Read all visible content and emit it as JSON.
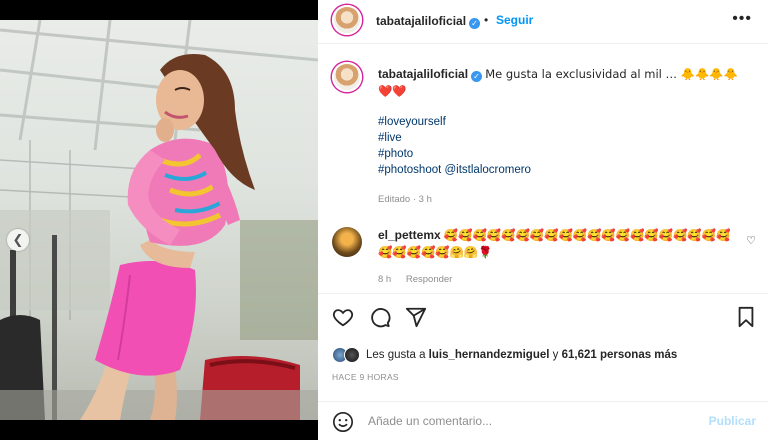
{
  "post": {
    "author": "tabatajaliloficial",
    "separator": "•",
    "follow_label": "Seguir",
    "more_label": "•••",
    "caption": "Me gusta la exclusividad al mil … 🐥🐥🐥🐥 ❤️❤️",
    "hashtags": [
      "#loveyourself",
      "#live",
      "#photo",
      "#photoshoot @itstlalocromero"
    ],
    "edited_meta": "Editado · 3 h"
  },
  "comment": {
    "author": "el_pettemx",
    "text": "🥰🥰🥰🥰🥰🥰🥰🥰🥰🥰🥰🥰🥰🥰🥰🥰🥰🥰🥰🥰🥰🥰🥰🥰🥰🤗🤗🌹",
    "time": "8 h",
    "reply_label": "Responder"
  },
  "likes": {
    "prefix": "Les gusta a",
    "user": "luis_hernandezmiguel",
    "middle": "y",
    "count": "61,621 personas más"
  },
  "time_ago": "HACE 9 HORAS",
  "add_comment": {
    "placeholder": "Añade un comentario...",
    "publish_label": "Publicar"
  },
  "carousel": {
    "slides": 5,
    "active_index": 4
  },
  "icons": [
    "chevron-left-icon",
    "verified-icon",
    "more-icon",
    "heart-icon",
    "comment-icon",
    "share-icon",
    "save-icon",
    "smile-icon"
  ],
  "colors": {
    "accent": "#0095f6",
    "verified": "#3897f0",
    "link": "#00376b",
    "muted": "#8e8e8e",
    "publish_disabled": "#b2dffc"
  }
}
